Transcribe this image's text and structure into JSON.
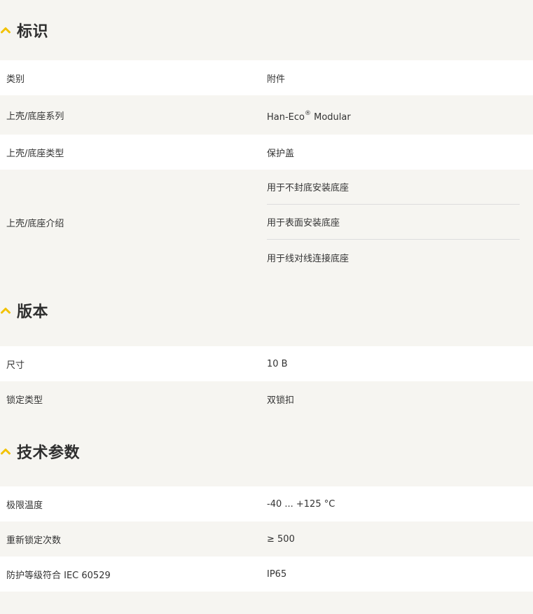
{
  "sections": [
    {
      "title": "标识",
      "rows": [
        {
          "label": "类别",
          "value": "附件"
        },
        {
          "label": "上壳/底座系列",
          "value_main": "Han-Eco",
          "value_sup": "®",
          "value_tail": " Modular"
        },
        {
          "label": "上壳/底座类型",
          "value": "保护盖"
        },
        {
          "label": "上壳/底座介绍",
          "values": [
            "用于不封底安装底座",
            "用于表面安装底座",
            "用于线对线连接底座"
          ]
        }
      ]
    },
    {
      "title": "版本",
      "rows": [
        {
          "label": "尺寸",
          "value": "10 B"
        },
        {
          "label": "锁定类型",
          "value": "双锁扣"
        }
      ]
    },
    {
      "title": "技术参数",
      "rows": [
        {
          "label": "极限温度",
          "value": "-40 ... +125 °C"
        },
        {
          "label": "重新锁定次数",
          "value": "≥ 500"
        },
        {
          "label": "防护等级符合 IEC 60529",
          "value": "IP65"
        }
      ]
    }
  ],
  "colors": {
    "accent": "#f2c200",
    "row_white": "#ffffff",
    "row_grey": "#f6f5f1",
    "text": "#333333"
  },
  "icons": {
    "section_toggle": "chevron-up-icon"
  }
}
